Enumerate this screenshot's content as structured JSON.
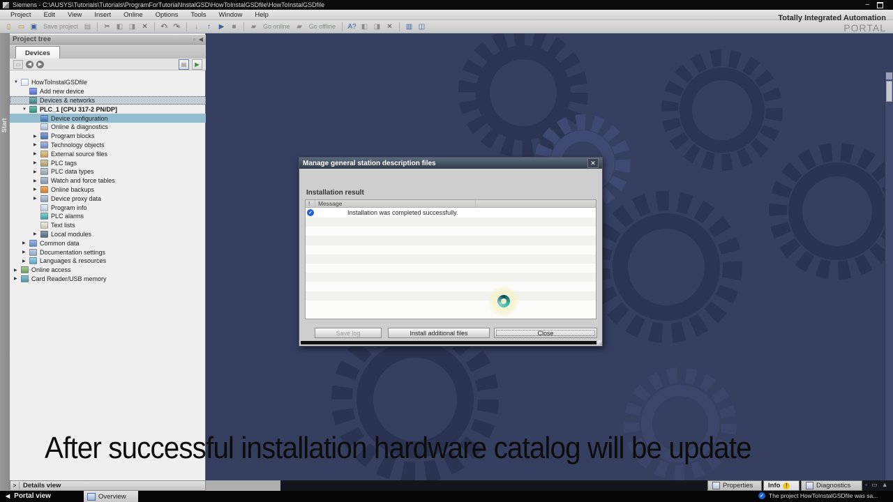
{
  "window": {
    "title": "Siemens  -  C:\\AUSYS\\Tutorials\\Tutorials\\ProgramForTutorial\\InstalGSD\\HowToInstalGSDfile\\HowToInstalGSDfile",
    "brand_line1": "Totally Integrated Automation",
    "brand_line2": "PORTAL"
  },
  "menu": {
    "items": [
      "Project",
      "Edit",
      "View",
      "Insert",
      "Online",
      "Options",
      "Tools",
      "Window",
      "Help"
    ]
  },
  "toolbar": {
    "save_project_label": "Save project",
    "go_online_label": "Go online",
    "go_offline_label": "Go offline"
  },
  "start_tab_label": "Start",
  "project_tree": {
    "title": "Project tree",
    "devices_tab": "Devices",
    "items": [
      {
        "label": "HowToInstalGSDfile",
        "level": 0,
        "arrow": "down",
        "icon": "project"
      },
      {
        "label": "Add new device",
        "level": 1,
        "arrow": "",
        "icon": "add-new-device"
      },
      {
        "label": "Devices & networks",
        "level": 1,
        "arrow": "",
        "icon": "devices-networks",
        "state": "selected-dotted"
      },
      {
        "label": "PLC_1 [CPU 317-2 PN/DP]",
        "level": 1,
        "arrow": "down",
        "icon": "plc",
        "bold": true
      },
      {
        "label": "Device configuration",
        "level": 2,
        "arrow": "",
        "icon": "device-config",
        "state": "selected-blue"
      },
      {
        "label": "Online & diagnostics",
        "level": 2,
        "arrow": "",
        "icon": "online-diagnostics"
      },
      {
        "label": "Program blocks",
        "level": 2,
        "arrow": "right",
        "icon": "program-blocks"
      },
      {
        "label": "Technology objects",
        "level": 2,
        "arrow": "right",
        "icon": "technology-objects"
      },
      {
        "label": "External source files",
        "level": 2,
        "arrow": "right",
        "icon": "external-sources"
      },
      {
        "label": "PLC tags",
        "level": 2,
        "arrow": "right",
        "icon": "plc-tags"
      },
      {
        "label": "PLC data types",
        "level": 2,
        "arrow": "right",
        "icon": "plc-data-types"
      },
      {
        "label": "Watch and force tables",
        "level": 2,
        "arrow": "right",
        "icon": "watch-tables"
      },
      {
        "label": "Online backups",
        "level": 2,
        "arrow": "right",
        "icon": "online-backups"
      },
      {
        "label": "Device proxy data",
        "level": 2,
        "arrow": "right",
        "icon": "device-proxy"
      },
      {
        "label": "Program info",
        "level": 2,
        "arrow": "",
        "icon": "program-info"
      },
      {
        "label": "PLC alarms",
        "level": 2,
        "arrow": "",
        "icon": "plc-alarms"
      },
      {
        "label": "Text lists",
        "level": 2,
        "arrow": "",
        "icon": "text-lists"
      },
      {
        "label": "Local modules",
        "level": 2,
        "arrow": "right",
        "icon": "local-modules"
      },
      {
        "label": "Common data",
        "level": 1,
        "arrow": "right",
        "icon": "common-data"
      },
      {
        "label": "Documentation settings",
        "level": 1,
        "arrow": "right",
        "icon": "doc-settings"
      },
      {
        "label": "Languages & resources",
        "level": 1,
        "arrow": "right",
        "icon": "languages"
      },
      {
        "label": "Online access",
        "level": 0,
        "arrow": "right",
        "icon": "online-access"
      },
      {
        "label": "Card Reader/USB memory",
        "level": 0,
        "arrow": "right",
        "icon": "card-reader"
      }
    ]
  },
  "dialog": {
    "title": "Manage general station description files",
    "section": "Installation result",
    "table": {
      "col_flag": "!",
      "col_message": "Message",
      "rows": [
        {
          "message": "Installation was completed successfully."
        }
      ],
      "empty_row_count": 10
    },
    "buttons": {
      "save_log": "Save log",
      "install": "Install additional files",
      "close": "Close"
    }
  },
  "caption": "After successful installation hardware catalog will be update",
  "bottom": {
    "details_view": "Details view",
    "portal_view": "Portal view",
    "overview_tab": "Overview",
    "tabs": [
      "Properties",
      "Info",
      "Diagnostics"
    ],
    "status": "The project HowToInstalGSDfile was sa..."
  },
  "icons": {
    "check": "✓",
    "scissors": "✂",
    "close": "✕",
    "undo": "↶",
    "redo": "↷",
    "arrow_down": "▼",
    "arrow_right": "▶",
    "arrow_left": "◀",
    "chevron_right": ">",
    "minimize": "–",
    "plusminus": "±",
    "info_mark": "!",
    "up": "↓",
    "up2": "↑",
    "page": "▯",
    "folder": "▭",
    "floppy": "▣",
    "printer": "▤",
    "copy": "◧",
    "paste": "◨",
    "play": "▶",
    "stop": "■",
    "plug": "▰",
    "search": "A?",
    "split": "◫",
    "panel": "▥",
    "dock": "▫",
    "bar": "▭",
    "expand": "▲"
  },
  "colors": {
    "workspace_bg": "#353f60",
    "gear_dark": "#2c3453",
    "gear_light": "#3f4a72",
    "selection_blue": "#93bccf",
    "dialog_title_bg": "#313c49",
    "success_check": "#1b5fd0",
    "info_badge": "#f0c520",
    "spinner_halo": "#f5f2cc",
    "spinner_ring": "#1f8a7e"
  }
}
